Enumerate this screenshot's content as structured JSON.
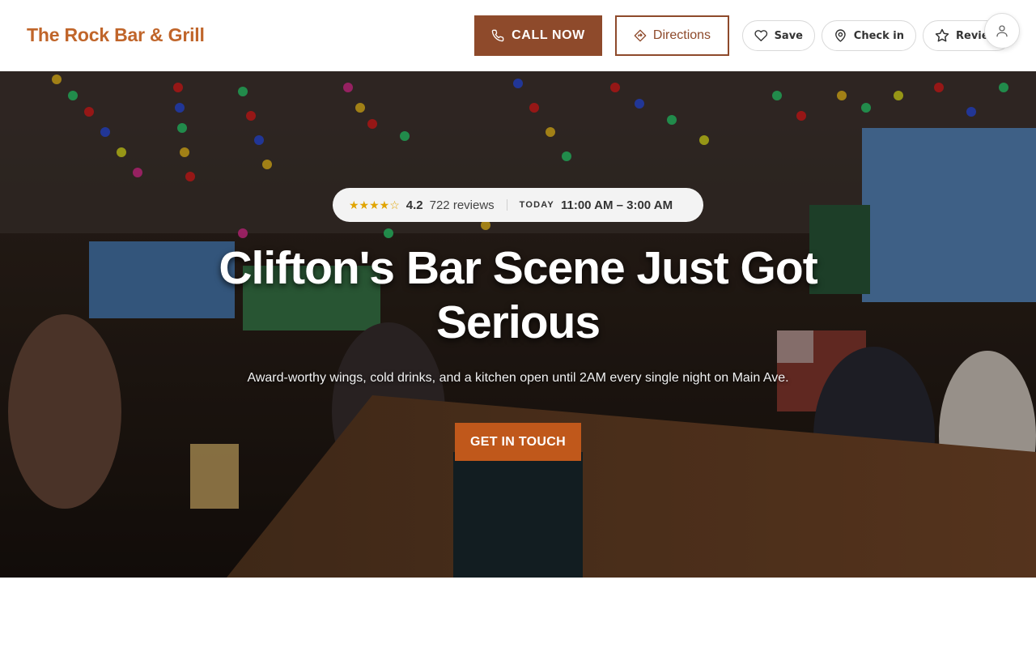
{
  "brand": {
    "name": "The Rock Bar & Grill"
  },
  "header": {
    "call_label": "CALL NOW",
    "directions_label": "Directions",
    "save_label": "Save",
    "checkin_label": "Check in",
    "review_label": "Review"
  },
  "hero": {
    "rating": "4.2",
    "rating_value": 4.2,
    "stars_text": "★★★★☆",
    "reviews": "722 reviews",
    "today_label": "TODAY",
    "hours": "11:00 AM – 3:00 AM",
    "title": "Clifton's Bar Scene Just Got Serious",
    "subtitle": "Award-worthy wings, cold drinks, and a kitchen open until 2AM every single night on Main Ave.",
    "cta_label": "GET IN TOUCH"
  },
  "icons": {
    "call": "phone-icon",
    "directions": "directions-icon",
    "save": "heart-icon",
    "checkin": "map-pin-icon",
    "review": "star-icon",
    "account": "user-icon"
  },
  "colors": {
    "brand": "#c0652a",
    "primary_button": "#8e4a2b",
    "cta": "#c0581b",
    "star": "#e0a400"
  }
}
